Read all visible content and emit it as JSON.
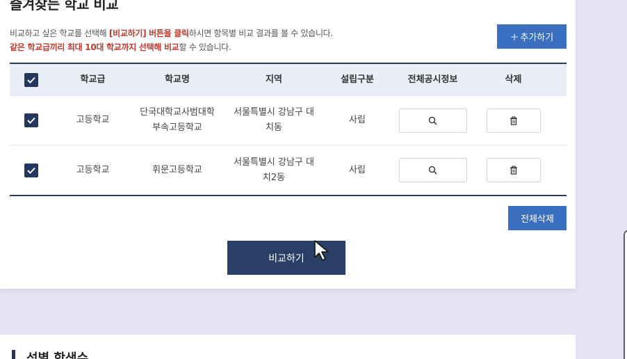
{
  "panel": {
    "title": "즐겨찾는 학교 비교",
    "desc_line1_a": "비교하고 싶은 학교를 선택해 ",
    "desc_line1_b": "[비교하기] 버튼을 클릭",
    "desc_line1_c": "하시면 항목별 비교 결과를 볼 수 있습니다.",
    "desc_line2_a": "같은 학교급끼리 최대 10대 학교까지 선택해 비교",
    "desc_line2_b": "할 수 있습니다.",
    "add_button": "추가하기",
    "add_plus": "+"
  },
  "table": {
    "headers": {
      "level": "학교급",
      "name": "학교명",
      "region": "지역",
      "type": "설립구분",
      "info": "전체공시정보",
      "delete": "삭제"
    },
    "rows": [
      {
        "checked": true,
        "level": "고등학교",
        "name_l1": "단국대학교사범대학",
        "name_l2": "부속고등학교",
        "region_l1": "서울특별시 강남구 대",
        "region_l2": "치동",
        "type": "사립"
      },
      {
        "checked": true,
        "level": "고등학교",
        "name_l1": "휘문고등학교",
        "name_l2": "",
        "region_l1": "서울특별시 강남구 대",
        "region_l2": "치2동",
        "type": "사립"
      }
    ]
  },
  "actions": {
    "delete_all": "전체삭제",
    "compare": "비교하기"
  },
  "next_section": {
    "title": "성별 학생수"
  },
  "icons": {
    "check": "check-icon",
    "search": "search-icon",
    "trash": "trash-icon",
    "cursor": "mouse-pointer-icon"
  },
  "colors": {
    "primary_button": "#3a6fc0",
    "dark_navy": "#2a3f66",
    "highlight_red": "#c0392b",
    "header_bg": "#e9eef7",
    "page_bg": "#e4e2f3"
  }
}
